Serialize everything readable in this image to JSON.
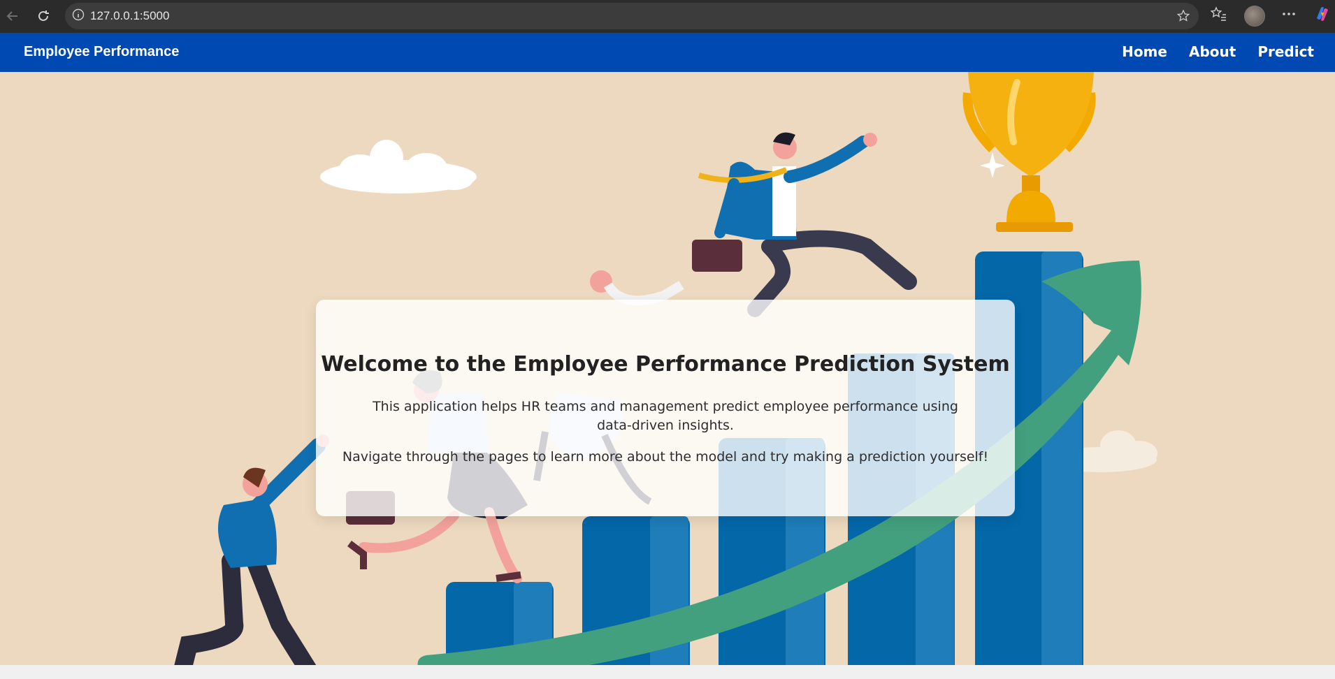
{
  "browser": {
    "url": "127.0.0.1:5000"
  },
  "navbar": {
    "brand": "Employee Performance",
    "links": [
      "Home",
      "About",
      "Predict"
    ]
  },
  "hero": {
    "title": "Welcome to the Employee Performance Prediction System",
    "paragraph1": "This application helps HR teams and management predict employee performance using data-driven insights.",
    "paragraph2": "Navigate through the pages to learn more about the model and try making a prediction yourself!"
  },
  "colors": {
    "navbar": "#0049b3",
    "background": "#edd9bf",
    "bars": "#0467a8",
    "arrow": "#43a07e",
    "trophy": "#f2a900"
  }
}
